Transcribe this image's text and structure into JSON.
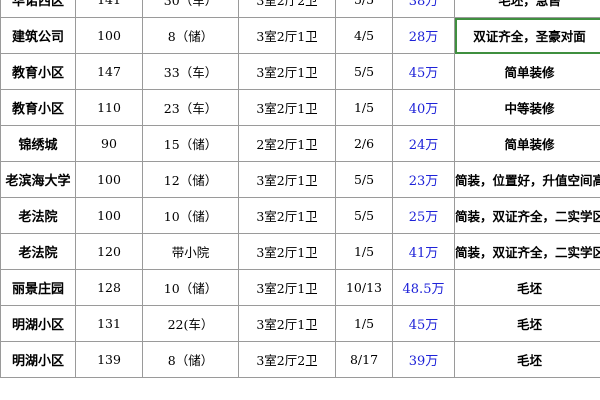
{
  "sheet": {
    "selection_color": "#3f8f3f",
    "price_color": "#1e22d8",
    "rows": [
      {
        "community": "华诺西区",
        "area": "141",
        "parking": "30（车）",
        "layout": "3室2厅2卫",
        "floor": "5/5",
        "price": "38万",
        "remarks": "毛坯，急售"
      },
      {
        "community": "建筑公司",
        "area": "100",
        "parking": "8（储）",
        "layout": "3室2厅1卫",
        "floor": "4/5",
        "price": "28万",
        "remarks": "双证齐全，圣豪对面"
      },
      {
        "community": "教育小区",
        "area": "147",
        "parking": "33（车）",
        "layout": "3室2厅1卫",
        "floor": "5/5",
        "price": "45万",
        "remarks": "简单装修"
      },
      {
        "community": "教育小区",
        "area": "110",
        "parking": "23（车）",
        "layout": "3室2厅1卫",
        "floor": "1/5",
        "price": "40万",
        "remarks": "中等装修"
      },
      {
        "community": "锦绣城",
        "area": "90",
        "parking": "15（储）",
        "layout": "2室2厅1卫",
        "floor": "2/6",
        "price": "24万",
        "remarks": "简单装修"
      },
      {
        "community": "老滨海大学",
        "area": "100",
        "parking": "12（储）",
        "layout": "3室2厅1卫",
        "floor": "5/5",
        "price": "23万",
        "remarks": "简装，位置好，升值空间高"
      },
      {
        "community": "老法院",
        "area": "100",
        "parking": "10（储）",
        "layout": "3室2厅1卫",
        "floor": "5/5",
        "price": "25万",
        "remarks": "简装，双证齐全，二实学区房"
      },
      {
        "community": "老法院",
        "area": "120",
        "parking": "带小院",
        "layout": "3室2厅1卫",
        "floor": "1/5",
        "price": "41万",
        "remarks": "简装，双证齐全，二实学区房"
      },
      {
        "community": "丽景庄园",
        "area": "128",
        "parking": "10（储）",
        "layout": "3室2厅1卫",
        "floor": "10/13",
        "price": "48.5万",
        "remarks": "毛坯"
      },
      {
        "community": "明湖小区",
        "area": "131",
        "parking": "22(车）",
        "layout": "3室2厅1卫",
        "floor": "1/5",
        "price": "45万",
        "remarks": "毛坯"
      },
      {
        "community": "明湖小区",
        "area": "139",
        "parking": "8（储）",
        "layout": "3室2厅2卫",
        "floor": "8/17",
        "price": "39万",
        "remarks": "毛坯"
      }
    ]
  }
}
